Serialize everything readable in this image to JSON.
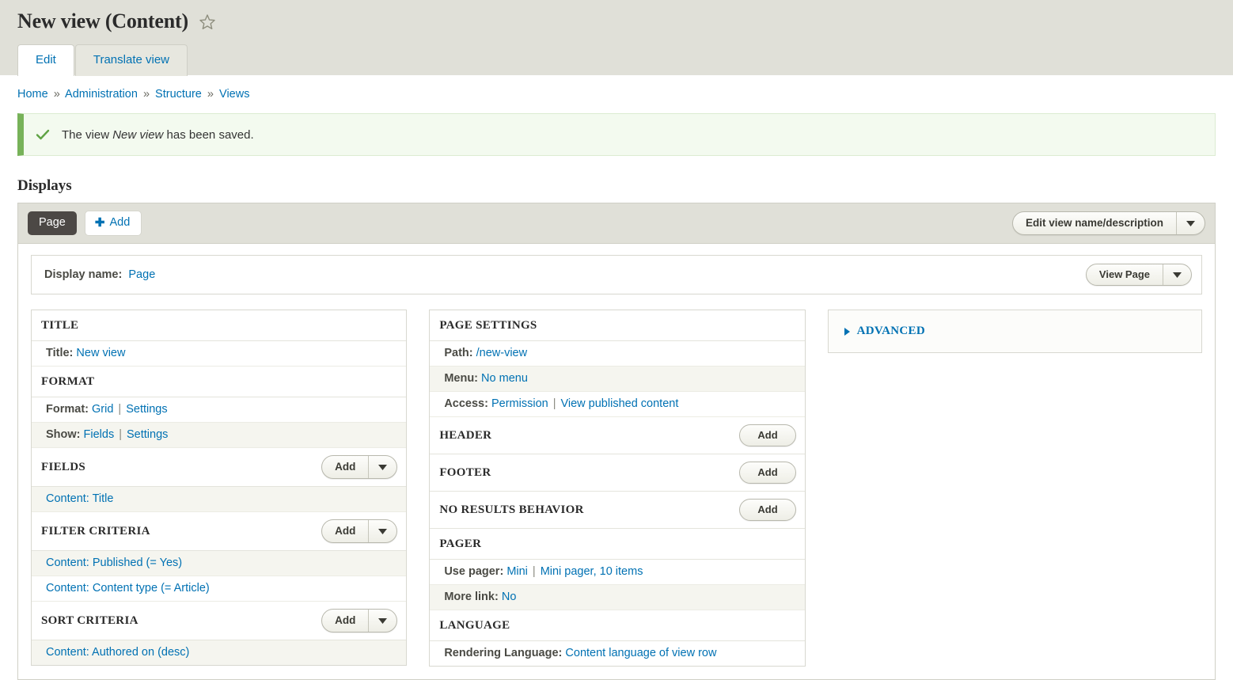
{
  "header": {
    "title": "New view (Content)",
    "star_icon": "star-outline-icon"
  },
  "tabs": [
    {
      "label": "Edit",
      "active": true
    },
    {
      "label": "Translate view",
      "active": false
    }
  ],
  "breadcrumb": [
    "Home",
    "Administration",
    "Structure",
    "Views"
  ],
  "breadcrumb_separator": "»",
  "status": {
    "icon": "checkmark-icon",
    "prefix": "The view ",
    "emphasis": "New view",
    "suffix": " has been saved."
  },
  "displays": {
    "heading": "Displays",
    "active_display": "Page",
    "add_label": "Add",
    "add_icon": "plus-icon",
    "edit_view_button": "Edit view name/description",
    "display_name_label": "Display name:",
    "display_name_value": "Page",
    "view_page_button": "View Page"
  },
  "column1": [
    {
      "title": "TITLE",
      "button": null,
      "rows": [
        {
          "label": "Title:",
          "links": [
            "New view"
          ],
          "alt": false
        }
      ]
    },
    {
      "title": "FORMAT",
      "button": null,
      "rows": [
        {
          "label": "Format:",
          "links": [
            "Grid",
            "Settings"
          ],
          "alt": false
        },
        {
          "label": "Show:",
          "links": [
            "Fields",
            "Settings"
          ],
          "alt": true
        }
      ]
    },
    {
      "title": "FIELDS",
      "button": {
        "label": "Add",
        "has_arrow": true
      },
      "rows": [
        {
          "label": "",
          "links": [
            "Content: Title"
          ],
          "alt": true
        }
      ]
    },
    {
      "title": "FILTER CRITERIA",
      "button": {
        "label": "Add",
        "has_arrow": true
      },
      "rows": [
        {
          "label": "",
          "links": [
            "Content: Published (= Yes)"
          ],
          "alt": true
        },
        {
          "label": "",
          "links": [
            "Content: Content type (= Article)"
          ],
          "alt": false
        }
      ]
    },
    {
      "title": "SORT CRITERIA",
      "button": {
        "label": "Add",
        "has_arrow": true
      },
      "rows": [
        {
          "label": "",
          "links": [
            "Content: Authored on (desc)"
          ],
          "alt": true
        }
      ]
    }
  ],
  "column2": [
    {
      "title": "PAGE SETTINGS",
      "button": null,
      "rows": [
        {
          "label": "Path:",
          "links": [
            "/new-view"
          ],
          "alt": false
        },
        {
          "label": "Menu:",
          "links": [
            "No menu"
          ],
          "alt": true
        },
        {
          "label": "Access:",
          "links": [
            "Permission",
            "View published content"
          ],
          "alt": false
        }
      ]
    },
    {
      "title": "HEADER",
      "button": {
        "label": "Add",
        "has_arrow": false
      },
      "rows": []
    },
    {
      "title": "FOOTER",
      "button": {
        "label": "Add",
        "has_arrow": false
      },
      "rows": []
    },
    {
      "title": "NO RESULTS BEHAVIOR",
      "button": {
        "label": "Add",
        "has_arrow": false
      },
      "rows": []
    },
    {
      "title": "PAGER",
      "button": null,
      "rows": [
        {
          "label": "Use pager:",
          "links": [
            "Mini",
            "Mini pager, 10 items"
          ],
          "alt": false
        },
        {
          "label": "More link:",
          "links": [
            "No"
          ],
          "alt": true
        }
      ]
    },
    {
      "title": "LANGUAGE",
      "button": null,
      "rows": [
        {
          "label": "Rendering Language:",
          "links": [
            "Content language of view row"
          ],
          "alt": false
        }
      ]
    }
  ],
  "advanced": {
    "label": "ADVANCED",
    "expanded": false,
    "toggle_icon": "triangle-right-icon"
  },
  "colors": {
    "header_bg": "#e0e0d8",
    "link": "#0071b3",
    "status_border": "#77b259",
    "status_bg": "#f3faef",
    "active_tab_bg": "#4c4845",
    "row_alt_bg": "#f5f5ef"
  }
}
